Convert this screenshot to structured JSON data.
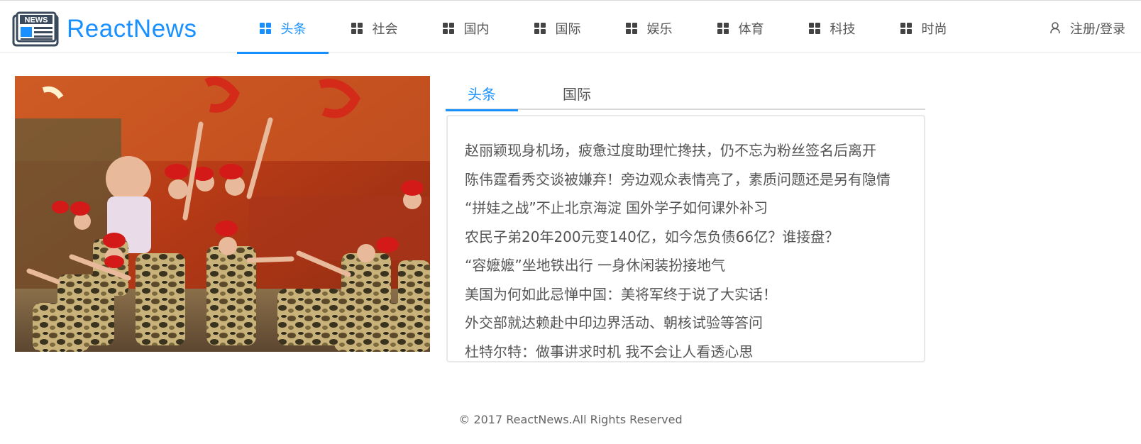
{
  "app": {
    "title": "ReactNews",
    "logo_icon": "newspaper-icon",
    "logo_badge": "NEWS",
    "accent_color": "#1890ff"
  },
  "nav": {
    "items": [
      {
        "label": "头条",
        "icon": "appstore-icon",
        "active": true
      },
      {
        "label": "社会",
        "icon": "appstore-icon",
        "active": false
      },
      {
        "label": "国内",
        "icon": "appstore-icon",
        "active": false
      },
      {
        "label": "国际",
        "icon": "appstore-icon",
        "active": false
      },
      {
        "label": "娱乐",
        "icon": "appstore-icon",
        "active": false
      },
      {
        "label": "体育",
        "icon": "appstore-icon",
        "active": false
      },
      {
        "label": "科技",
        "icon": "appstore-icon",
        "active": false
      },
      {
        "label": "时尚",
        "icon": "appstore-icon",
        "active": false
      }
    ],
    "login": {
      "label": "注册/登录",
      "icon": "user-icon"
    }
  },
  "carousel": {
    "image_subject": "performers in camouflage uniforms and red berets dancing on a stage"
  },
  "tabs": [
    {
      "label": "头条",
      "active": true
    },
    {
      "label": "国际",
      "active": false
    }
  ],
  "news_list": [
    "赵丽颖现身机场，疲惫过度助理忙搀扶，仍不忘为粉丝签名后离开",
    "陈伟霆看秀交谈被嫌弃！旁边观众表情亮了，素质问题还是另有隐情",
    "“拼娃之战”不止北京海淀 国外学子如何课外补习",
    "农民子弟20年200元变140亿，如今怎负债66亿？谁接盘？",
    "“容嬷嬷”坐地铁出行 一身休闲装扮接地气",
    "美国为何如此忌惮中国：美将军终于说了大实话！",
    "外交部就达赖赴中印边界活动、朝核试验等答问",
    "杜特尔特：做事讲求时机 我不会让人看透心思"
  ],
  "footer": {
    "copyright": "© 2017 ReactNews.All Rights Reserved"
  }
}
